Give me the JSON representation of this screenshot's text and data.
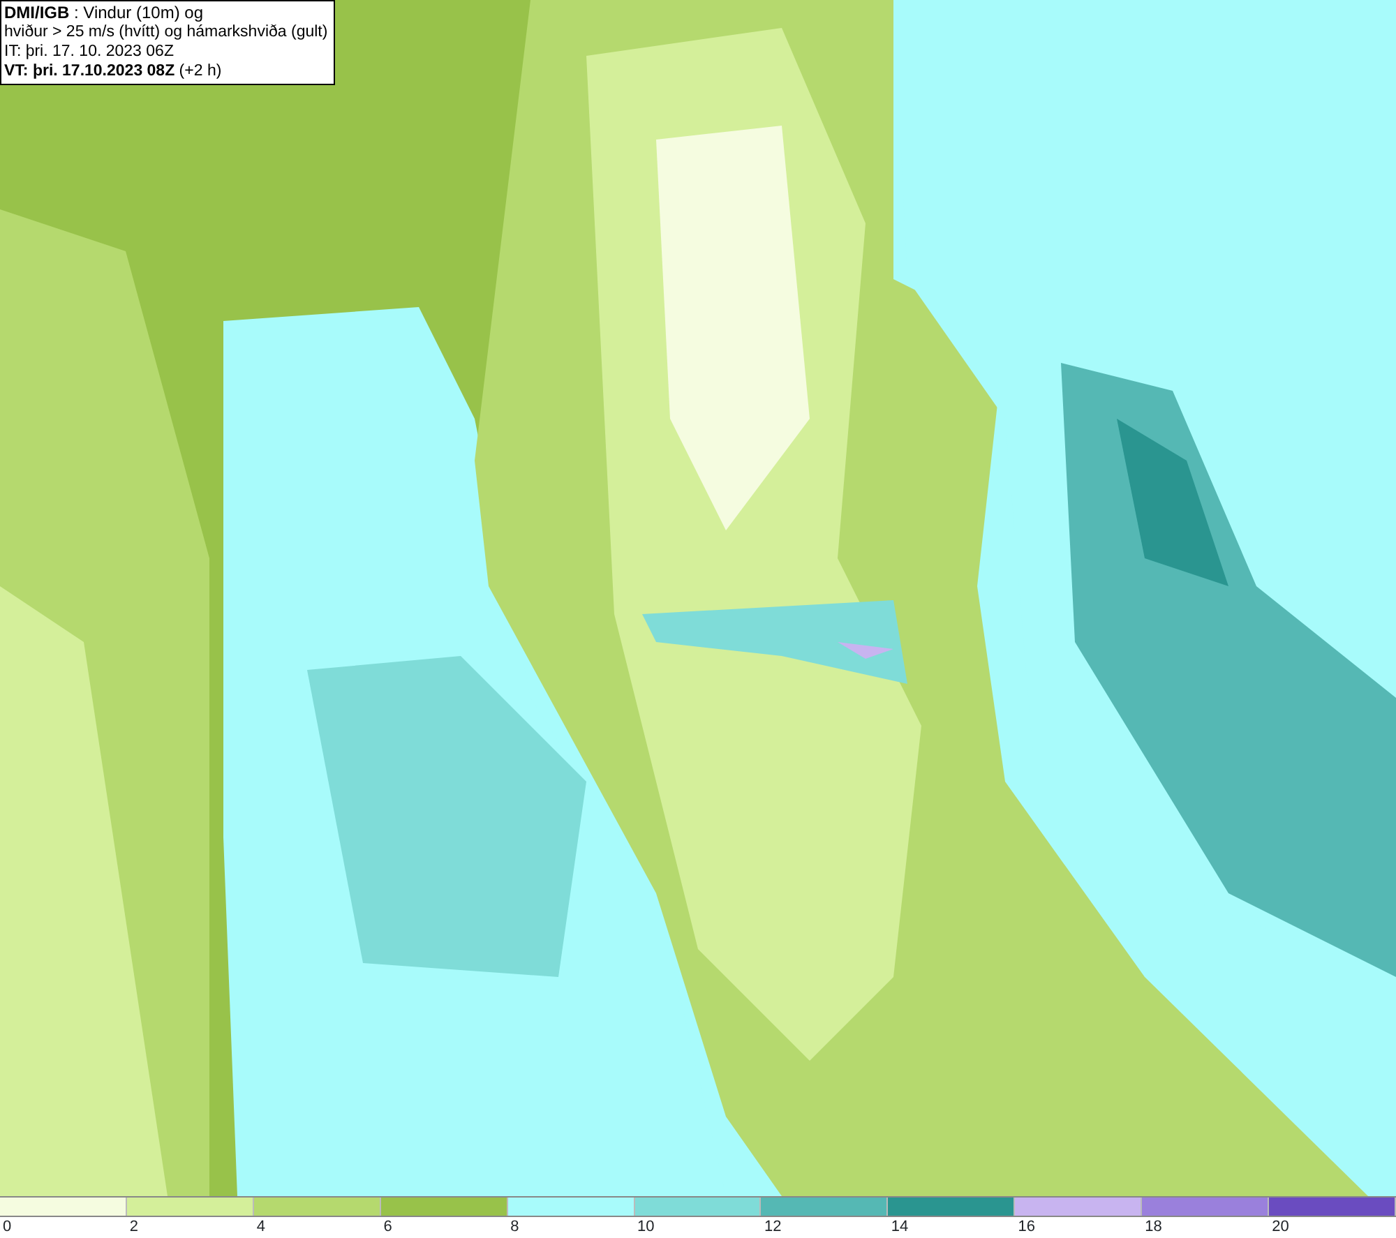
{
  "header": {
    "lines": [
      "**DMI/IGB** : Vindur (10m) og",
      "hviður > 25 m/s (hvítt) og hámarkshviða (gult)",
      "IT: þri. 17. 10. 2023 06Z",
      "**VT: þri. 17.10.2023 08Z** (+2 h)"
    ]
  },
  "legend": {
    "bins": [
      {
        "color": "#f5fce0"
      },
      {
        "color": "#d4ef9a"
      },
      {
        "color": "#b5d96e"
      },
      {
        "color": "#98c24a"
      },
      {
        "color": "#a8fbfb"
      },
      {
        "color": "#7fdcd8"
      },
      {
        "color": "#55b8b4"
      },
      {
        "color": "#2a9590"
      },
      {
        "color": "#c8b4f0"
      },
      {
        "color": "#9a80dc"
      },
      {
        "color": "#6a4cc0"
      }
    ],
    "labels": [
      "0",
      "2",
      "4",
      "6",
      "8",
      "10",
      "12",
      "14",
      "16",
      "18",
      "20"
    ]
  }
}
